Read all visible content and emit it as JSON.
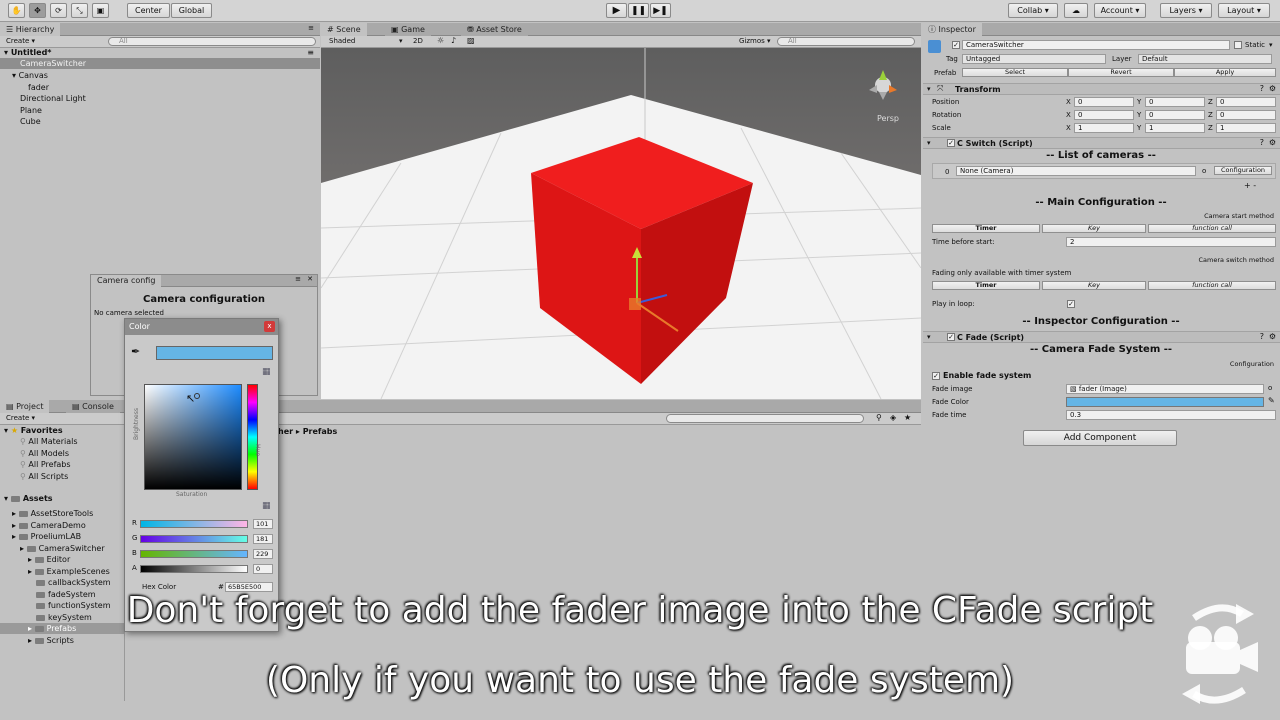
{
  "toolbar": {
    "pivot_label": "Center",
    "space_label": "Global",
    "collab_label": "Collab ▾",
    "account_label": "Account",
    "layers_label": "Layers",
    "layout_label": "Layout"
  },
  "hierarchy": {
    "tab_label": "Hierarchy",
    "create_label": "Create ▾",
    "search_placeholder": "All",
    "scene_name": "Untitled*",
    "items": [
      "CameraSwitcher",
      "Canvas",
      "fader",
      "Directional Light",
      "Plane",
      "Cube"
    ]
  },
  "scene": {
    "tabs": [
      "Scene",
      "Game",
      "Asset Store"
    ],
    "shading": "Shaded",
    "mode_2d": "2D",
    "gizmos_label": "Gizmos ▾",
    "search_placeholder": "All",
    "persp_label": "Persp"
  },
  "camera_config": {
    "tab_label": "Camera config",
    "title": "Camera configuration",
    "status": "No  camera selected"
  },
  "color_picker": {
    "title": "Color",
    "close": "x",
    "brightness_label": "Brightness",
    "saturation_label": "Saturation",
    "hue_label": "Hue",
    "channels": [
      {
        "label": "R",
        "value": "101"
      },
      {
        "label": "G",
        "value": "181"
      },
      {
        "label": "B",
        "value": "229"
      },
      {
        "label": "A",
        "value": "0"
      }
    ],
    "hex_label": "Hex Color",
    "hex_prefix": "#",
    "hex_value": "65B5E500",
    "swatch_color": "#65b5e5"
  },
  "project": {
    "tabs": [
      "Project",
      "Console"
    ],
    "create_label": "Create ▾",
    "breadcrumb_tail": "her",
    "breadcrumb_sep": "▸",
    "breadcrumb_current": "Prefabs",
    "favorites_label": "Favorites",
    "favorites": [
      "All Materials",
      "All Models",
      "All Prefabs",
      "All Scripts"
    ],
    "assets_label": "Assets",
    "assets": [
      {
        "name": "AssetStoreTools",
        "depth": 1
      },
      {
        "name": "CameraDemo",
        "depth": 1
      },
      {
        "name": "ProeliumLAB",
        "depth": 1
      },
      {
        "name": "CameraSwitcher",
        "depth": 2
      },
      {
        "name": "Editor",
        "depth": 3
      },
      {
        "name": "ExampleScenes",
        "depth": 3
      },
      {
        "name": "callbackSystem",
        "depth": 4
      },
      {
        "name": "fadeSystem",
        "depth": 4
      },
      {
        "name": "functionSystem",
        "depth": 4
      },
      {
        "name": "keySystem",
        "depth": 4
      },
      {
        "name": "Prefabs",
        "depth": 3
      },
      {
        "name": "Scripts",
        "depth": 3
      }
    ]
  },
  "inspector": {
    "tab_label": "Inspector",
    "object_name": "CameraSwitcher",
    "static_label": "Static",
    "tag_label": "Tag",
    "tag_value": "Untagged",
    "layer_label": "Layer",
    "layer_value": "Default",
    "prefab_label": "Prefab",
    "prefab_select": "Select",
    "prefab_revert": "Revert",
    "prefab_apply": "Apply",
    "transform": {
      "title": "Transform",
      "rows": [
        {
          "label": "Position",
          "x": "0",
          "y": "0",
          "z": "0"
        },
        {
          "label": "Rotation",
          "x": "0",
          "y": "0",
          "z": "0"
        },
        {
          "label": "Scale",
          "x": "1",
          "y": "1",
          "z": "1"
        }
      ]
    },
    "cswitch": {
      "title": "C Switch (Script)",
      "list_header": "-- List of cameras --",
      "list_index": "0",
      "list_value": "None (Camera)",
      "list_circle": "o",
      "config_button": "Configuration",
      "add_remove": "+ -",
      "main_header": "-- Main Configuration --",
      "start_method_label": "Camera start method",
      "methods": [
        "Timer",
        "Key",
        "function call"
      ],
      "time_before_label": "Time before start:",
      "time_before_value": "2",
      "switch_method_label": "Camera switch method",
      "fading_note": "Fading only available with timer system",
      "play_loop_label": "Play in loop:",
      "inspector_header": "-- Inspector Configuration --"
    },
    "cfade": {
      "title": "C Fade (Script)",
      "header": "-- Camera Fade System --",
      "config_label": "Configuration",
      "enable_label": "Enable fade system",
      "fade_image_label": "Fade image",
      "fade_image_value": "fader (Image)",
      "fade_color_label": "Fade Color",
      "fade_color": "#65b5e5",
      "fade_time_label": "Fade time",
      "fade_time_value": "0.3"
    },
    "add_component": "Add Component"
  },
  "subtitles": {
    "line1": "Don't forget to add the fader image into the CFade script",
    "line2": "(Only if you want to use the fade system)"
  },
  "colors": {
    "cube": "#e81a1a",
    "selection_blue": "#3d7bc5"
  }
}
